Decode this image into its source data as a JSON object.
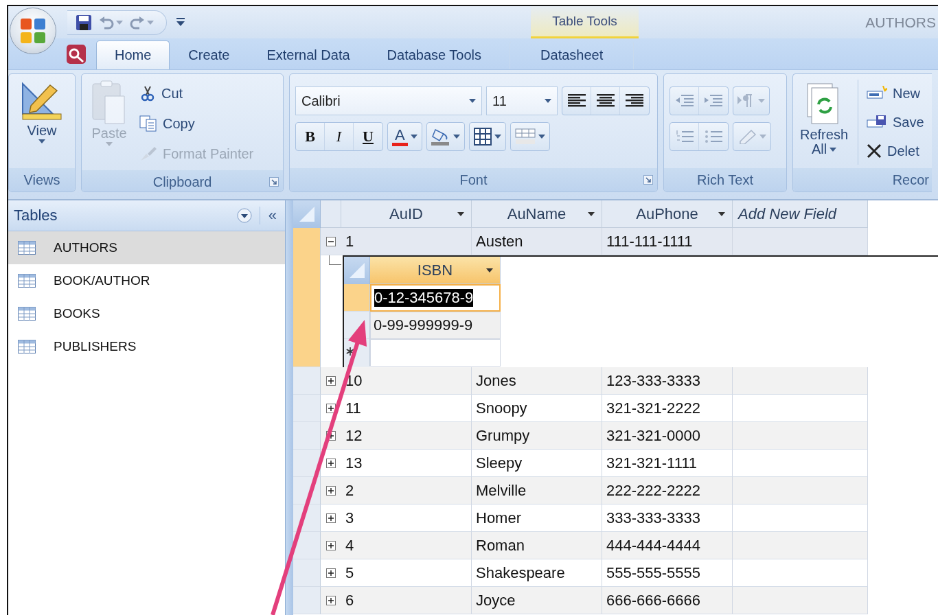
{
  "title_bar": {
    "contextual_group": "Table Tools",
    "document_title": "AUTHORS"
  },
  "tabs": [
    {
      "label": "Home",
      "selected": true,
      "contextual": false
    },
    {
      "label": "Create",
      "selected": false,
      "contextual": false
    },
    {
      "label": "External Data",
      "selected": false,
      "contextual": false
    },
    {
      "label": "Database Tools",
      "selected": false,
      "contextual": false
    },
    {
      "label": "Datasheet",
      "selected": false,
      "contextual": true
    }
  ],
  "ribbon": {
    "views": {
      "label": "Views",
      "view": "View"
    },
    "clipboard": {
      "label": "Clipboard",
      "paste": {
        "label": "Paste",
        "disabled": true
      },
      "cut": {
        "label": "Cut",
        "disabled": false
      },
      "copy": {
        "label": "Copy",
        "disabled": false
      },
      "format_painter": {
        "label": "Format Painter",
        "disabled": true
      }
    },
    "font": {
      "label": "Font",
      "font_name": "Calibri",
      "font_size": "11",
      "bold": "B",
      "italic": "I",
      "underline": "U",
      "font_color": "A"
    },
    "rich_text": {
      "label": "Rich Text"
    },
    "records": {
      "label": "Recor",
      "refresh": "Refresh",
      "refresh_all": "All",
      "new": "New",
      "save": "Save",
      "delete": "Delet"
    }
  },
  "navigation": {
    "title": "Tables",
    "collapse": "«",
    "items": [
      {
        "label": "AUTHORS",
        "selected": true
      },
      {
        "label": "BOOK/AUTHOR",
        "selected": false
      },
      {
        "label": "BOOKS",
        "selected": false
      },
      {
        "label": "PUBLISHERS",
        "selected": false
      }
    ]
  },
  "datasheet": {
    "columns": [
      {
        "label": "AuID",
        "kind": "field"
      },
      {
        "label": "AuName",
        "kind": "field"
      },
      {
        "label": "AuPhone",
        "kind": "field"
      },
      {
        "label": "Add New Field",
        "kind": "new"
      }
    ],
    "records": [
      {
        "cells": [
          "1",
          "Austen",
          "111-111-1111"
        ],
        "expanded": true,
        "selected": true,
        "subdatasheet": {
          "column": "ISBN",
          "rows": [
            {
              "value": "0-12-345678-9",
              "selected": true
            },
            {
              "value": "0-99-999999-9",
              "selected": false
            }
          ]
        }
      },
      {
        "cells": [
          "10",
          "Jones",
          "123-333-3333"
        ],
        "expanded": false,
        "selected": false
      },
      {
        "cells": [
          "11",
          "Snoopy",
          "321-321-2222"
        ],
        "expanded": false,
        "selected": false
      },
      {
        "cells": [
          "12",
          "Grumpy",
          "321-321-0000"
        ],
        "expanded": false,
        "selected": false
      },
      {
        "cells": [
          "13",
          "Sleepy",
          "321-321-1111"
        ],
        "expanded": false,
        "selected": false
      },
      {
        "cells": [
          "2",
          "Melville",
          "222-222-2222"
        ],
        "expanded": false,
        "selected": false
      },
      {
        "cells": [
          "3",
          "Homer",
          "333-333-3333"
        ],
        "expanded": false,
        "selected": false
      },
      {
        "cells": [
          "4",
          "Roman",
          "444-444-4444"
        ],
        "expanded": false,
        "selected": false
      },
      {
        "cells": [
          "5",
          "Shakespeare",
          "555-555-5555"
        ],
        "expanded": false,
        "selected": false
      },
      {
        "cells": [
          "6",
          "Joyce",
          "666-666-6666"
        ],
        "expanded": false,
        "selected": false
      }
    ]
  }
}
